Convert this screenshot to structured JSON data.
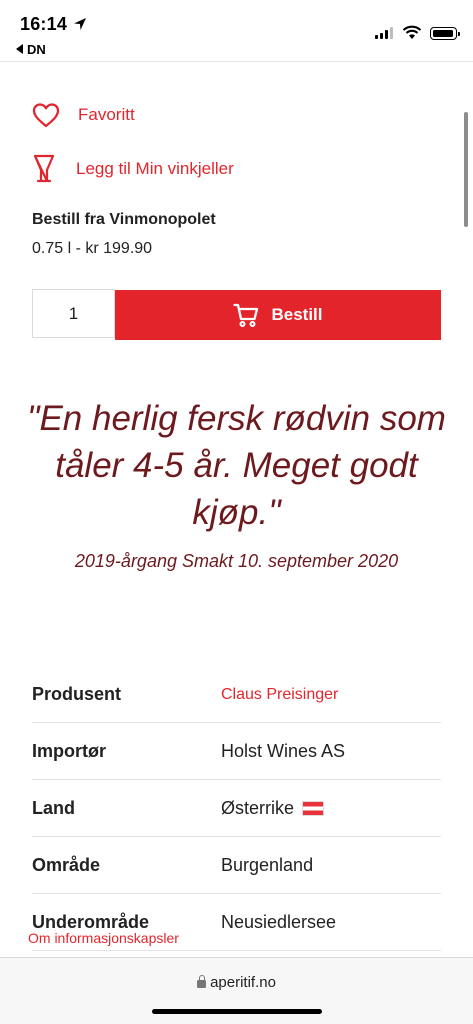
{
  "status_bar": {
    "time": "16:14",
    "back_label": "DN"
  },
  "actions": {
    "favorite_label": "Favoritt",
    "cellar_label": "Legg til Min vinkjeller"
  },
  "order": {
    "title": "Bestill fra Vinmonopolet",
    "price": "0.75 l - kr 199.90",
    "quantity": "1",
    "button_label": "Bestill"
  },
  "review": {
    "quote": "\"En herlig fersk rødvin som tåler 4-5 år. Meget godt kjøp.\"",
    "tasted": "2019-årgang Smakt 10. september 2020"
  },
  "info": [
    {
      "label": "Produsent",
      "value": "Claus Preisinger",
      "link": true
    },
    {
      "label": "Importør",
      "value": "Holst Wines AS"
    },
    {
      "label": "Land",
      "value": "Østerrike",
      "flag": "austria-flag-icon"
    },
    {
      "label": "Område",
      "value": "Burgenland"
    },
    {
      "label": "Underområde",
      "value": "Neusiedlersee"
    }
  ],
  "cookie_link": "Om informasjonskapsler",
  "browser": {
    "url": "aperitif.no"
  },
  "colors": {
    "accent": "#e3242b",
    "quote": "#6d1a1e"
  }
}
